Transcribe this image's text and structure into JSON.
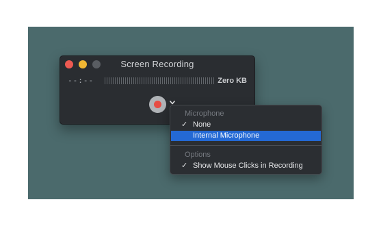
{
  "window": {
    "title": "Screen Recording",
    "elapsed_time": "--:--",
    "file_size": "Zero KB"
  },
  "icons": {
    "record": "record-icon",
    "chevron": "chevron-down-icon",
    "check": "checkmark-icon"
  },
  "colors": {
    "desktop": "#4b6a6c",
    "window_bg": "#2a2d31",
    "close_light": "#ee5a52",
    "minimize_light": "#f1b733",
    "zoom_light": "#595d62",
    "record_dot": "#e64c44",
    "menu_highlight": "#2469d4"
  },
  "menu": {
    "microphone_header": "Microphone",
    "microphone_items": [
      {
        "label": "None",
        "checked": true,
        "check": "✓"
      },
      {
        "label": "Internal Microphone",
        "checked": false,
        "highlighted": true
      }
    ],
    "options_header": "Options",
    "options_items": [
      {
        "label": "Show Mouse Clicks in Recording",
        "checked": true,
        "check": "✓"
      }
    ]
  }
}
